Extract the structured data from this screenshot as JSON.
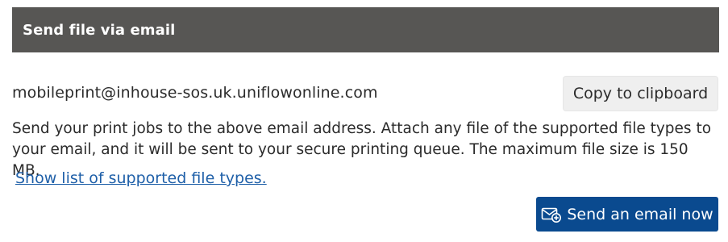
{
  "header": {
    "title": "Send file via email"
  },
  "email": {
    "address": "mobileprint@inhouse-sos.uk.uniflowonline.com",
    "copy_label": "Copy to clipboard"
  },
  "description": "Send your print jobs to the above email address. Attach any file of the supported file types to your email, and it will be sent to your secure printing queue. The maximum file size is 150 MB.",
  "supported_link": "Show list of supported file types.",
  "send_button": {
    "label": "Send an email now",
    "icon": "email-add-icon"
  },
  "colors": {
    "header_bg": "#575654",
    "primary_button": "#0a4a8f",
    "link": "#1e5fa8",
    "secondary_button": "#efefef"
  }
}
